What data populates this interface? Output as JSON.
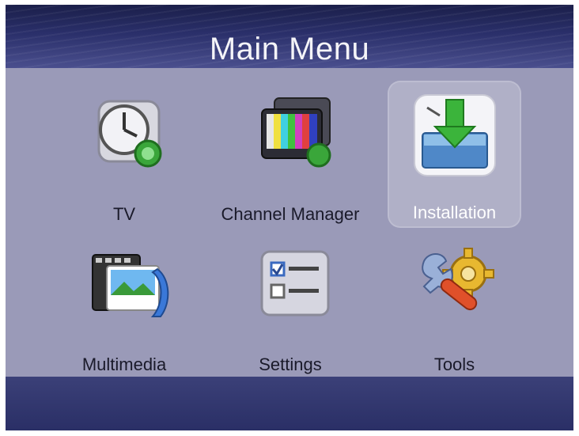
{
  "header": {
    "title": "Main Menu"
  },
  "menu": {
    "items": [
      {
        "label": "TV",
        "icon": "tv-clock-icon",
        "selected": false
      },
      {
        "label": "Channel Manager",
        "icon": "channel-manager-icon",
        "selected": false
      },
      {
        "label": "Installation",
        "icon": "installation-download-icon",
        "selected": true
      },
      {
        "label": "Multimedia",
        "icon": "multimedia-icon",
        "selected": false
      },
      {
        "label": "Settings",
        "icon": "settings-checklist-icon",
        "selected": false
      },
      {
        "label": "Tools",
        "icon": "tools-wrench-gear-icon",
        "selected": false
      }
    ]
  },
  "colors": {
    "background": "#9a9ab8",
    "header": "#2a2f6a",
    "footer": "#2e336c",
    "label_text": "#1a1a2a"
  }
}
